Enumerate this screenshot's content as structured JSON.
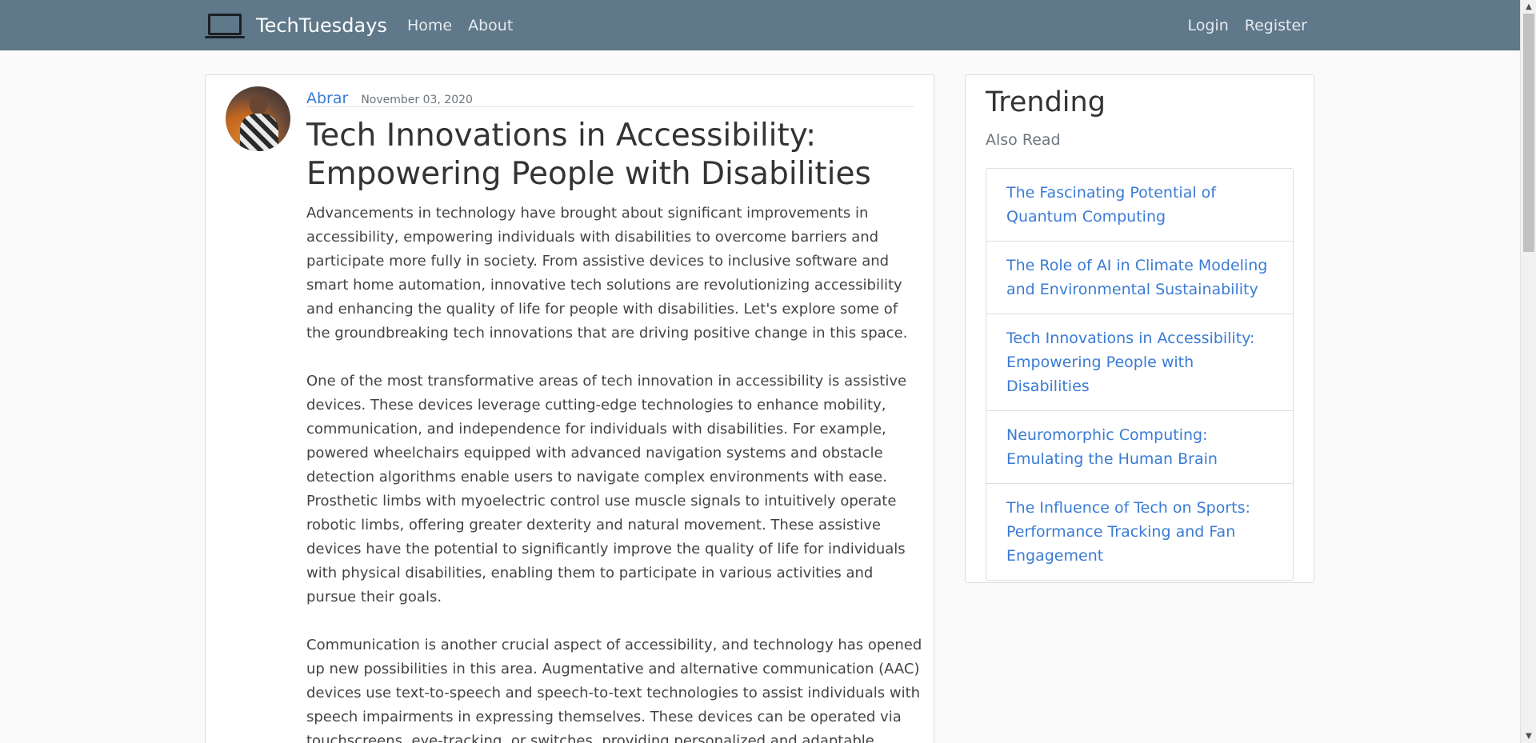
{
  "navbar": {
    "brand": "TechTuesdays",
    "brand_icon": "laptop-icon",
    "links_left": [
      "Home",
      "About"
    ],
    "links_right": [
      "Login",
      "Register"
    ],
    "background": "#5f788a"
  },
  "post": {
    "author": "Abrar",
    "date": "November 03, 2020",
    "title": "Tech Innovations in Accessibility: Empowering People with Disabilities",
    "paragraphs": [
      "Advancements in technology have brought about significant improvements in accessibility, empowering individuals with disabilities to overcome barriers and participate more fully in society. From assistive devices to inclusive software and smart home automation, innovative tech solutions are revolutionizing accessibility and enhancing the quality of life for people with disabilities. Let's explore some of the groundbreaking tech innovations that are driving positive change in this space.",
      "One of the most transformative areas of tech innovation in accessibility is assistive devices. These devices leverage cutting-edge technologies to enhance mobility, communication, and independence for individuals with disabilities. For example, powered wheelchairs equipped with advanced navigation systems and obstacle detection algorithms enable users to navigate complex environments with ease. Prosthetic limbs with myoelectric control use muscle signals to intuitively operate robotic limbs, offering greater dexterity and natural movement. These assistive devices have the potential to significantly improve the quality of life for individuals with physical disabilities, enabling them to participate in various activities and pursue their goals.",
      "Communication is another crucial aspect of accessibility, and technology has opened up new possibilities in this area. Augmentative and alternative communication (AAC) devices use text-to-speech and speech-to-text technologies to assist individuals with speech impairments in expressing themselves. These devices can be operated via touchscreens, eye-tracking, or switches, providing personalized and adaptable"
    ]
  },
  "sidebar": {
    "title": "Trending",
    "subtitle": "Also Read",
    "items": [
      "The Fascinating Potential of Quantum Computing",
      "The Role of AI in Climate Modeling and Environmental Sustainability",
      "Tech Innovations in Accessibility: Empowering People with Disabilities",
      "Neuromorphic Computing: Emulating the Human Brain",
      "The Influence of Tech on Sports: Performance Tracking and Fan Engagement"
    ]
  },
  "colors": {
    "link": "#3a7bd5",
    "page_background": "#fafafa"
  }
}
